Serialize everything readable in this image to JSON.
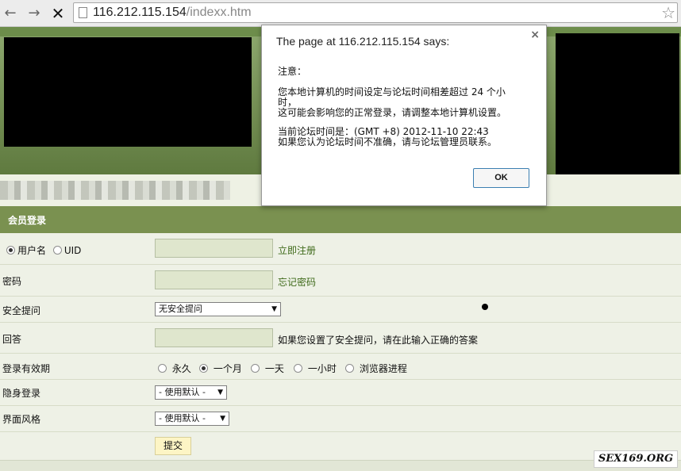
{
  "browser": {
    "url_host": "116.212.115.154",
    "url_path": "/indexx.htm"
  },
  "form": {
    "header": "会员登录",
    "username_option": "用户名",
    "uid_option": "UID",
    "register_link": "立即注册",
    "password_label": "密码",
    "forgot_link": "忘记密码",
    "question_label": "安全提问",
    "question_select": "无安全提问",
    "answer_label": "回答",
    "answer_hint": "如果您设置了安全提问，请在此输入正确的答案",
    "validity_label": "登录有效期",
    "validity_options": [
      "永久",
      "一个月",
      "一天",
      "一小时",
      "浏览器进程"
    ],
    "validity_selected": "一个月",
    "stealth_label": "隐身登录",
    "stealth_select": "- 使用默认 -",
    "style_label": "界面风格",
    "style_select": "- 使用默认 -",
    "submit_label": "提交"
  },
  "dialog": {
    "title": "The page at 116.212.115.154 says:",
    "line1": "注意：",
    "line2": "您本地计算机的时间设定与论坛时间相差超过  24 个小时，",
    "line3": "这可能会影响您的正常登录，请调整本地计算机设置。",
    "line4": "当前论坛时间是：(GMT +8) 2012-11-10 22:43",
    "line5": "如果您认为论坛时间不准确，请与论坛管理员联系。",
    "ok_label": "OK",
    "close_glyph": "×"
  },
  "watermark": "SEX169.ORG",
  "icons": {
    "back": "←",
    "forward": "→",
    "stop": "✕",
    "star": "☆",
    "dropdown": "▼"
  }
}
